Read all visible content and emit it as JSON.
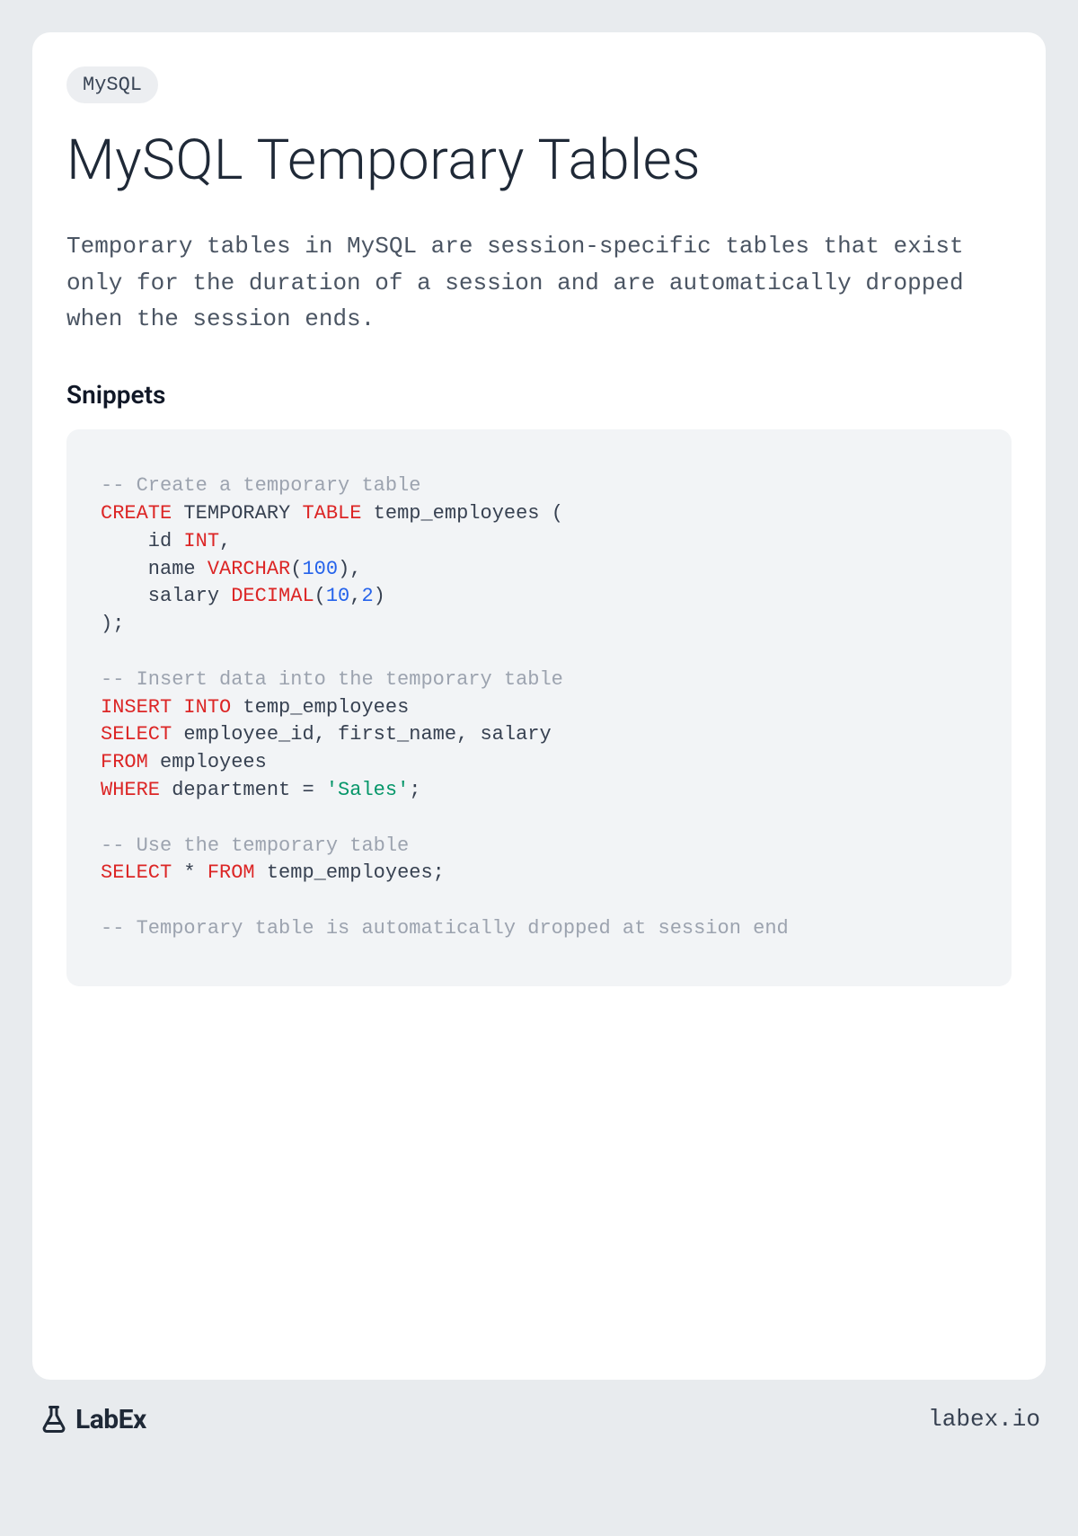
{
  "tag": "MySQL",
  "title": "MySQL Temporary Tables",
  "description": "Temporary tables in MySQL are session-specific tables that exist only for the duration of a session and are automatically dropped when the session ends.",
  "section_title": "Snippets",
  "code": {
    "comment1": "-- Create a temporary table",
    "kw_create": "CREATE",
    "plain_temporary": " TEMPORARY ",
    "kw_table": "TABLE",
    "plain_temp_emp": " temp_employees (",
    "plain_id": "    id ",
    "type_int": "INT",
    "plain_comma1": ",",
    "plain_name": "    name ",
    "type_varchar": "VARCHAR",
    "plain_paren_open1": "(",
    "num_100": "100",
    "plain_paren_close_comma": "),",
    "plain_salary": "    salary ",
    "type_decimal": "DECIMAL",
    "plain_paren_open2": "(",
    "num_10": "10",
    "plain_comma2": ",",
    "num_2": "2",
    "plain_paren_close2": ")",
    "plain_close_table": ");",
    "comment2": "-- Insert data into the temporary table",
    "kw_insert": "INSERT",
    "kw_into": "INTO",
    "plain_temp_emp2": " temp_employees",
    "kw_select1": "SELECT",
    "plain_select_cols": " employee_id, first_name, salary",
    "kw_from1": "FROM",
    "plain_employees": " employees",
    "kw_where": "WHERE",
    "plain_dept_eq": " department = ",
    "str_sales": "'Sales'",
    "plain_semi1": ";",
    "comment3": "-- Use the temporary table",
    "kw_select2": "SELECT",
    "plain_star": " * ",
    "kw_from2": "FROM",
    "plain_temp_emp3": " temp_employees;",
    "comment4": "-- Temporary table is automatically dropped at session end"
  },
  "footer": {
    "brand": "LabEx",
    "url": "labex.io"
  }
}
